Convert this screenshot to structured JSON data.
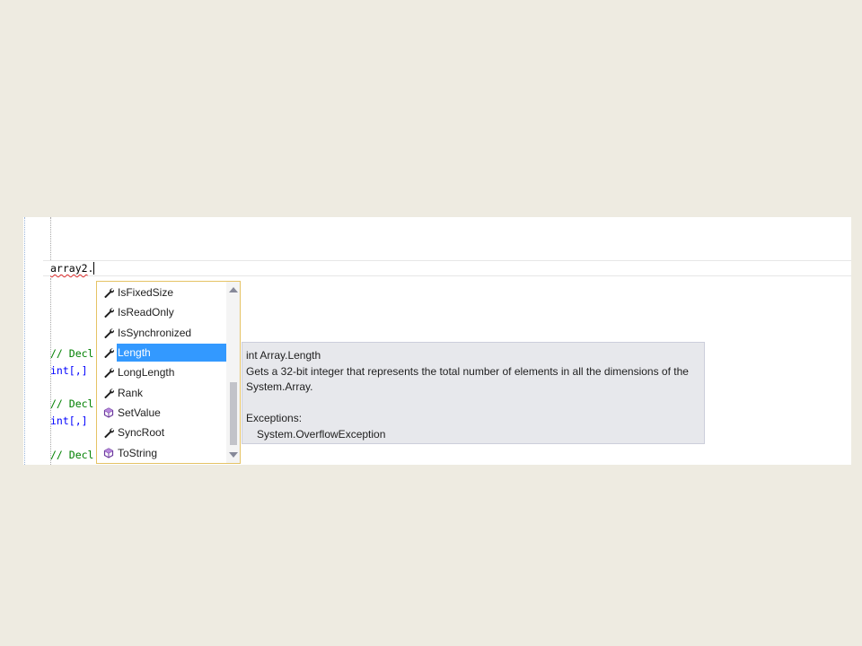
{
  "editor": {
    "lines": {
      "current": {
        "identifier": "array2",
        "dot": "."
      },
      "comment1": "// Decl",
      "decl1": {
        "type": "int[,]"
      },
      "comment2": "// Decl",
      "decl2": {
        "type": "int[,]"
      },
      "comment3": "// Decl"
    }
  },
  "completion": {
    "items": [
      {
        "label": "IsFixedSize",
        "icon": "property-wrench-icon"
      },
      {
        "label": "IsReadOnly",
        "icon": "property-wrench-icon"
      },
      {
        "label": "IsSynchronized",
        "icon": "property-wrench-icon"
      },
      {
        "label": "Length",
        "icon": "property-wrench-icon",
        "selected": true
      },
      {
        "label": "LongLength",
        "icon": "property-wrench-icon"
      },
      {
        "label": "Rank",
        "icon": "property-wrench-icon"
      },
      {
        "label": "SetValue",
        "icon": "method-cube-icon"
      },
      {
        "label": "SyncRoot",
        "icon": "property-wrench-icon"
      },
      {
        "label": "ToString",
        "icon": "method-cube-icon"
      }
    ]
  },
  "tooltip": {
    "signature": "int Array.Length",
    "description_line1": "Gets a 32-bit integer that represents the total number of elements in all the dimensions of the",
    "description_line2": "System.Array.",
    "exceptions_label": "Exceptions:",
    "exception": "System.OverflowException"
  },
  "colors": {
    "comment": "#008000",
    "keyword": "#0000FF",
    "selection": "#3399FF",
    "property_icon": "#1E1E1E",
    "method_icon": "#6C3A9E",
    "list_border": "#E5C365",
    "tooltip_bg": "#E7E8EC"
  }
}
